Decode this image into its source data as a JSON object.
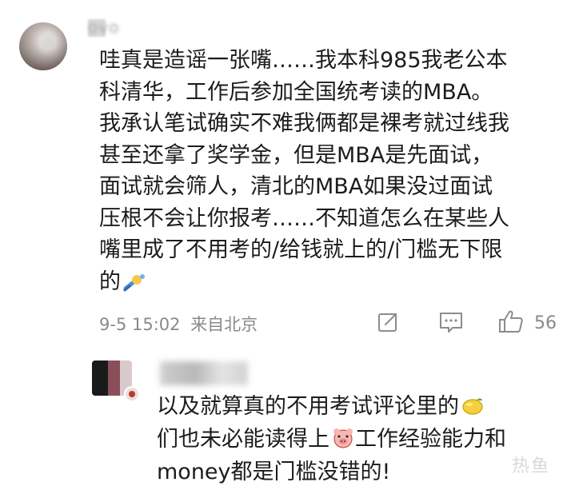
{
  "comment": {
    "author": "ovo",
    "lines": [
      "哇真是造谣一张嘴……我本科985我老公本",
      "科清华，工作后参加全国统考读的MBA。",
      "我承认笔试确实不难我俩都是裸考就过线我",
      "甚至还拿了奖学金，但是MBA是先面试，",
      "面试就会筛人，清北的MBA如果没过面试",
      "压根不会让你报考……不知道怎么在某些人",
      "嘴里成了不用考的/给钱就上的/门槛无下限",
      "的"
    ],
    "date": "9-5 15:02",
    "location": "来自北京",
    "likes": "56",
    "emoji_end": "sweat-emoji"
  },
  "reply": {
    "lines": [
      "以及就算真的不用考试评论里的",
      "们也未必能读得上",
      "工作经验能力和",
      "money都是门槛没错的!"
    ],
    "emoji_lemon": "lemon-emoji",
    "emoji_pig": "pig-emoji"
  },
  "watermark": "热鱼",
  "colors": {
    "text": "#1c1c1c",
    "meta": "#8a8a8a",
    "background": "#ffffff"
  }
}
